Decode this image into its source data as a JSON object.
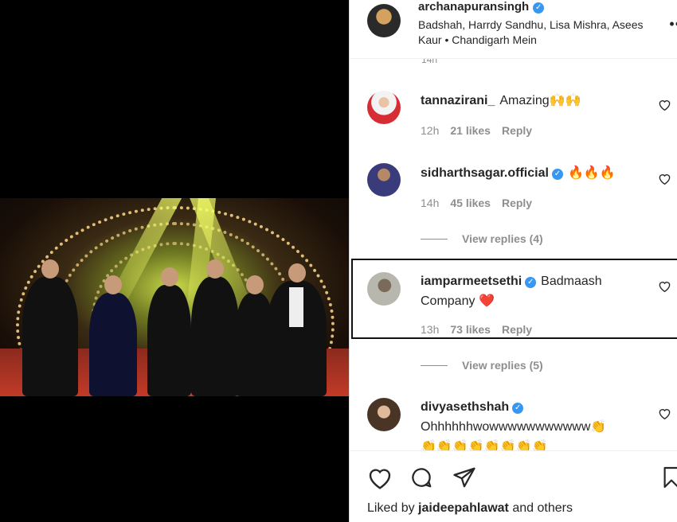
{
  "post": {
    "username": "archanapuransingh",
    "location_text": "Badshah, Harrdy Sandhu, Lisa Mishra, Asees Kaur • Chandigarh Mein",
    "more_label": "••"
  },
  "partial_time": "14h",
  "comments": [
    {
      "username": "tannazirani_",
      "text": "Amazing",
      "emoji": "🙌🙌",
      "time": "12h",
      "likes": "21 likes",
      "reply": "Reply"
    },
    {
      "username": "sidharthsagar.official",
      "text": "",
      "emoji": "🔥🔥🔥",
      "time": "14h",
      "likes": "45 likes",
      "reply": "Reply",
      "view_replies": "View replies (4)"
    },
    {
      "username": "iamparmeetsethi",
      "text": "Badmaash Company",
      "emoji": "❤️",
      "time": "13h",
      "likes": "73 likes",
      "reply": "Reply",
      "view_replies": "View replies (5)"
    },
    {
      "username": "divyasethshah",
      "text": "Ohhhhhhwowwwwwwwwwww",
      "emoji": "👏",
      "emoji_row": "👏👏👏👏👏👏👏👏"
    }
  ],
  "footer": {
    "liked_by_prefix": "Liked by",
    "liked_by_user": "jaideepahlawat",
    "liked_by_suffix": "and others"
  },
  "icons": [
    "like-heart-icon",
    "comment-icon",
    "share-icon",
    "save-bookmark-icon",
    "verified-badge-icon"
  ]
}
